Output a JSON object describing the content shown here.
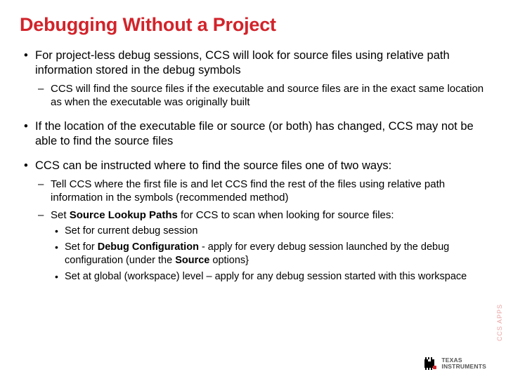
{
  "title": "Debugging Without a Project",
  "b1": "For project-less debug sessions, CCS will look for source files using relative path information stored in the debug symbols",
  "b1a": "CCS will find the source files if the executable and source files are in the exact same location as when the executable was originally built",
  "b2": "If the location of the executable file or source (or both) has changed, CCS may not be able to find the source files",
  "b3": "CCS can be instructed where to find the source files one of two ways:",
  "b3a": "Tell CCS where the first file is and let CCS find the rest of the files using relative path information in the symbols (recommended method)",
  "b3b_pre": "Set ",
  "b3b_bold": "Source Lookup Paths",
  "b3b_post": " for CCS to scan when looking for source files:",
  "b3b1": "Set for current debug session",
  "b3b2_pre": "Set for ",
  "b3b2_bold1": "Debug Configuration",
  "b3b2_mid": " - apply for every debug session launched by the debug configuration (under the ",
  "b3b2_bold2": "Source",
  "b3b2_post": " options}",
  "b3b3": "Set at global (workspace) level – apply for any debug session started with this workspace",
  "footer_brand_l1": "TEXAS",
  "footer_brand_l2": "INSTRUMENTS",
  "side": "CCS APPS"
}
